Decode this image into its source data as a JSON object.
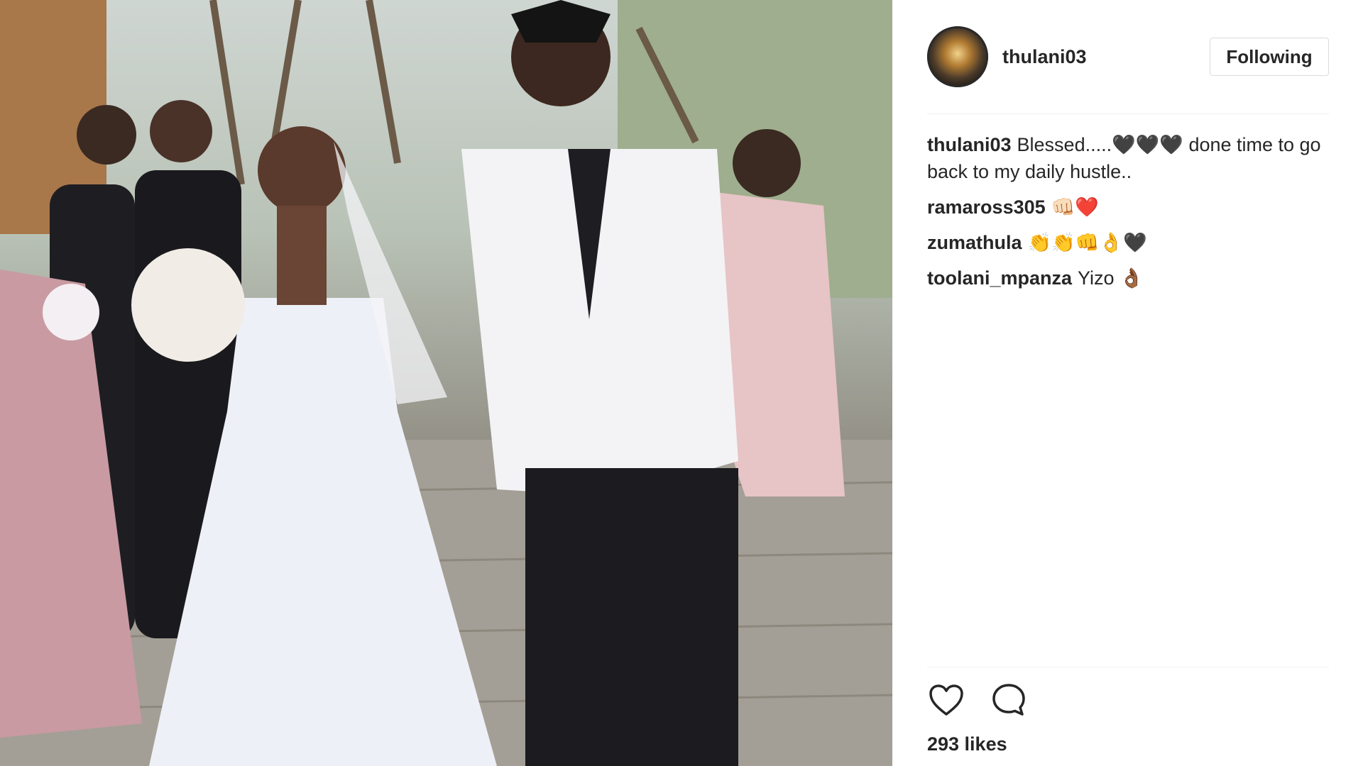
{
  "post": {
    "username": "thulani03",
    "follow_button": "Following",
    "comments": [
      {
        "user": "thulani03",
        "text": "Blessed.....🖤🖤🖤 done time to go back to my daily hustle.."
      },
      {
        "user": "ramaross305",
        "text": "👊🏻❤️"
      },
      {
        "user": "zumathula",
        "text": "👏👏👊👌🖤"
      },
      {
        "user": "toolani_mpanza",
        "text": "Yizo 👌🏾"
      }
    ],
    "likes": "293 likes"
  },
  "icons": {
    "like": "heart-icon",
    "comment": "comment-bubble-icon"
  }
}
